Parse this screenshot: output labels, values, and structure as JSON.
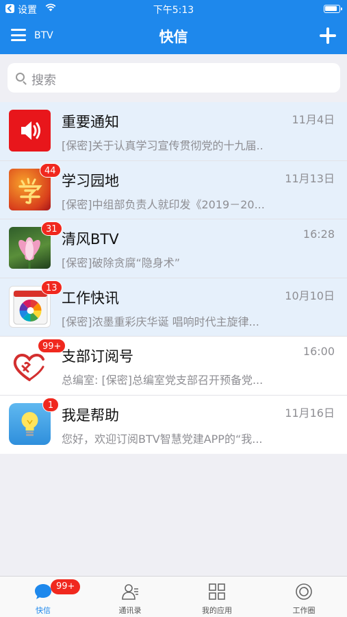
{
  "status_bar": {
    "carrier": "设置",
    "time": "下午5:13"
  },
  "header": {
    "account": "BTV",
    "title": "快信"
  },
  "search": {
    "placeholder": "搜索"
  },
  "conversations": [
    {
      "title": "重要通知",
      "time": "11月4日",
      "preview": "[保密]关于认真学习宣传贯彻党的十九届..",
      "badge": "",
      "icon": "speaker-icon",
      "pinned": true
    },
    {
      "title": "学习园地",
      "time": "11月13日",
      "preview": "[保密]中组部负责人就印发《2019－20...",
      "badge": "44",
      "icon": "study-logo-icon",
      "pinned": true
    },
    {
      "title": "清风BTV",
      "time": "16:28",
      "preview": "[保密]破除贪腐“隐身术”",
      "badge": "31",
      "icon": "lotus-icon",
      "pinned": true
    },
    {
      "title": "工作快讯",
      "time": "10月10日",
      "preview": "[保密]浓墨重彩庆华诞 唱响时代主旋律...",
      "badge": "13",
      "icon": "calendar-icon",
      "pinned": true
    },
    {
      "title": "支部订阅号",
      "time": "16:00",
      "preview": "总编室: [保密]总编室党支部召开预备党...",
      "badge": "99+",
      "icon": "party-emblem-icon",
      "pinned": false
    },
    {
      "title": "我是帮助",
      "time": "11月16日",
      "preview": "您好，欢迎订阅BTV智慧党建APP的“我...",
      "badge": "1",
      "icon": "lightbulb-icon",
      "pinned": false
    }
  ],
  "tabbar": {
    "items": [
      {
        "label": "快信",
        "badge": "99+",
        "icon": "chat-bubble-icon",
        "active": true
      },
      {
        "label": "通讯录",
        "icon": "contacts-icon",
        "active": false
      },
      {
        "label": "我的应用",
        "icon": "apps-grid-icon",
        "active": false
      },
      {
        "label": "工作圈",
        "icon": "work-circle-icon",
        "active": false
      }
    ]
  },
  "colors": {
    "brand": "#1e88ec",
    "badge": "#f0281e",
    "pinned_row": "#e6f0fb"
  }
}
